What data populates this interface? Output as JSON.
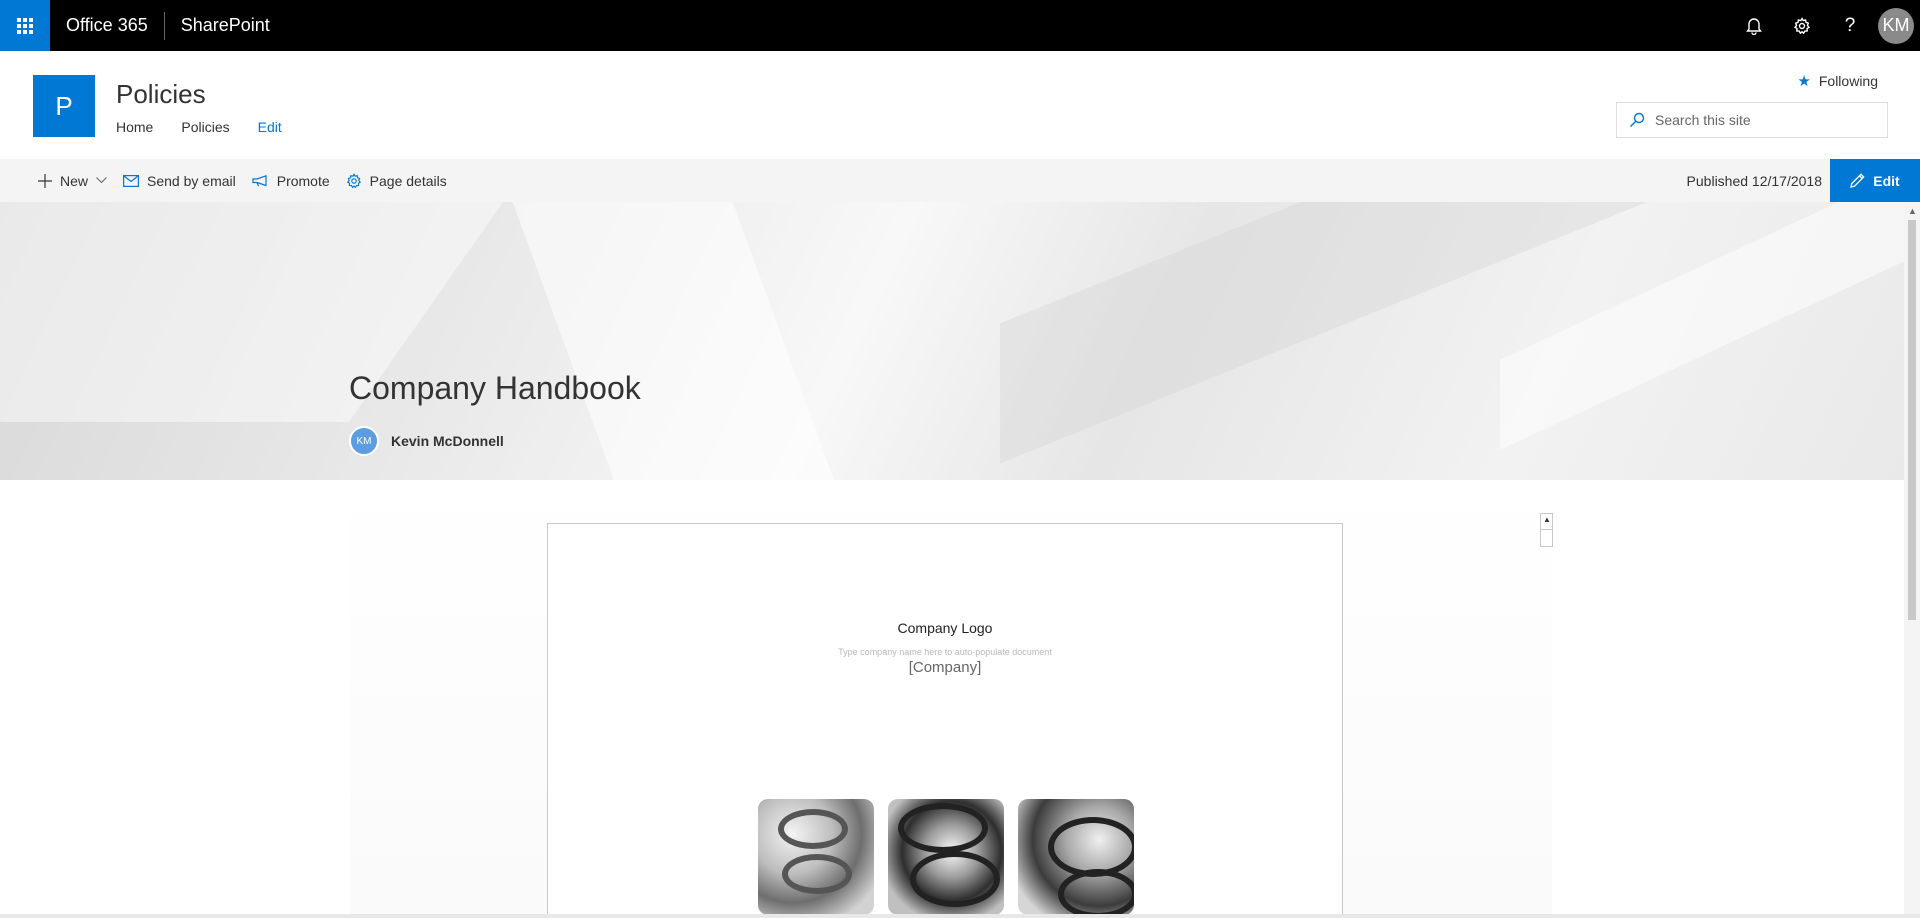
{
  "suite_bar": {
    "app_name": "Office 365",
    "product_name": "SharePoint",
    "user_initials": "KM",
    "icons": [
      "app-launcher-icon",
      "bell-icon",
      "gear-icon",
      "help-icon"
    ]
  },
  "site": {
    "logo_letter": "P",
    "title": "Policies",
    "nav": [
      {
        "label": "Home"
      },
      {
        "label": "Policies"
      },
      {
        "label": "Edit"
      }
    ],
    "following_label": "Following",
    "search_placeholder": "Search this site"
  },
  "command_bar": {
    "new_label": "New",
    "send_email_label": "Send by email",
    "promote_label": "Promote",
    "page_details_label": "Page details",
    "published_text": "Published 12/17/2018",
    "edit_label": "Edit"
  },
  "hero": {
    "title": "Company Handbook",
    "author_initials": "KM",
    "author_name": "Kevin McDonnell"
  },
  "document": {
    "logo_text": "Company Logo",
    "hint_text": "Type company name here to auto-populate document",
    "company_placeholder": "[Company]"
  },
  "colors": {
    "accent": "#0078d4",
    "suite_bar": "#000000",
    "command_bar": "#f4f4f4"
  }
}
